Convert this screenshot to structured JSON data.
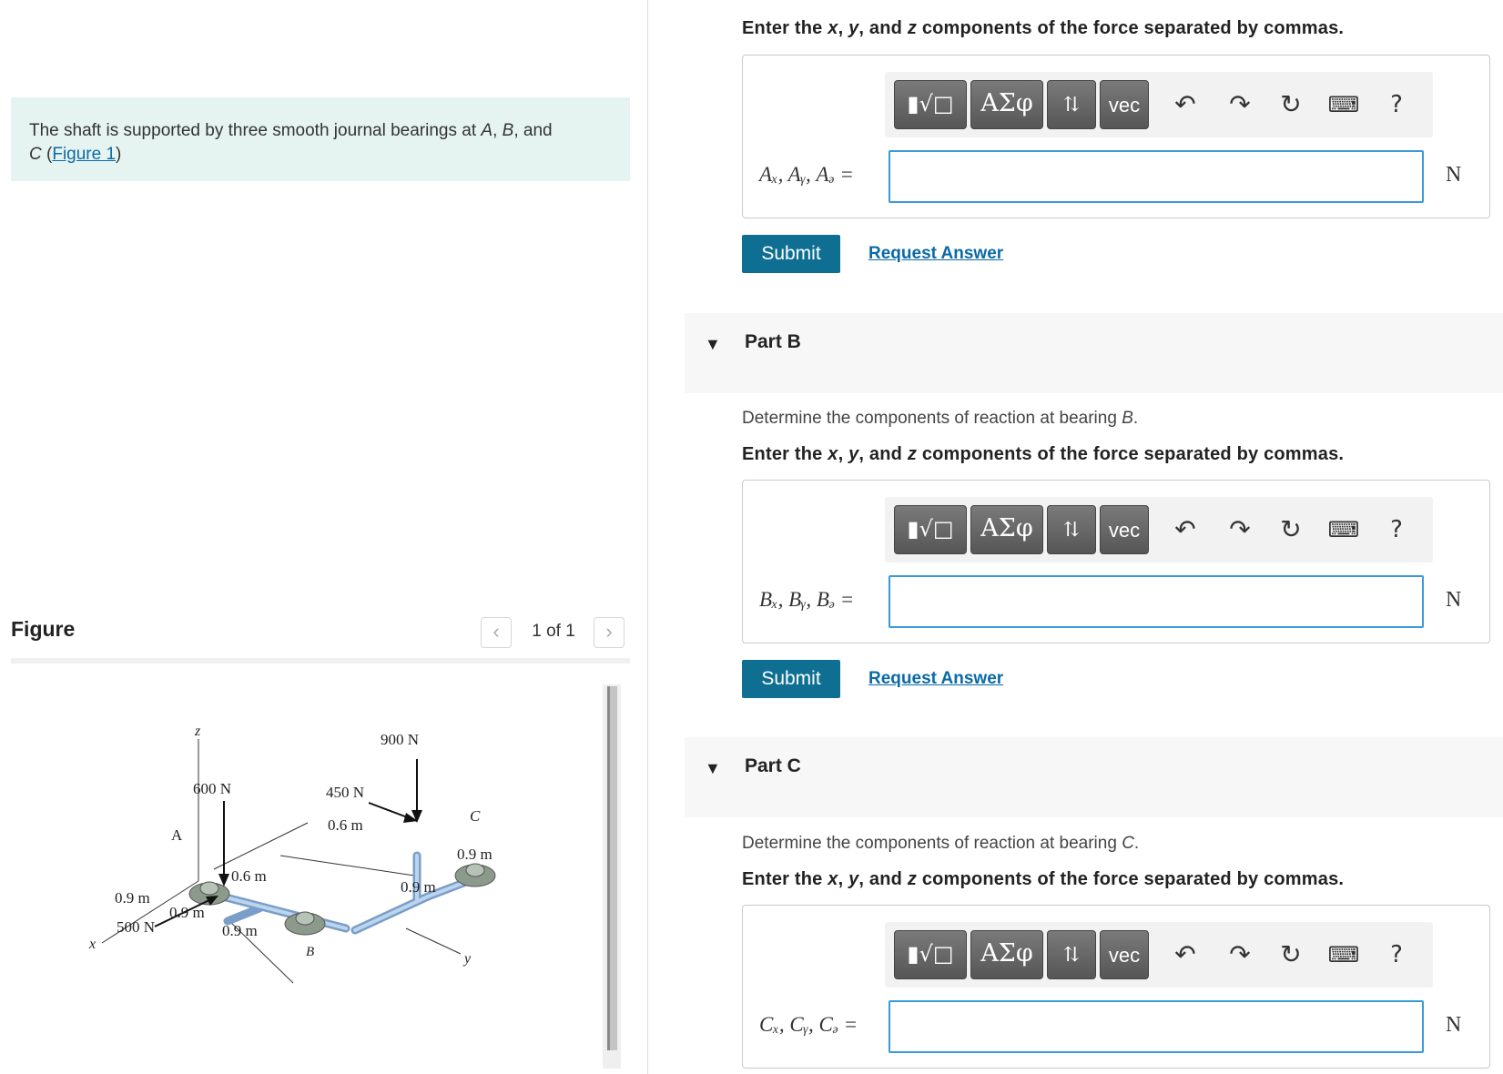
{
  "problem": {
    "text_prefix": "The shaft is supported by three smooth journal bearings at ",
    "bearing_a": "A",
    "sep1": ", ",
    "bearing_b": "B",
    "sep2": ", and",
    "bearing_c": "C",
    "paren_open": " (",
    "figure_link": "Figure 1",
    "paren_close": ")"
  },
  "figure": {
    "title": "Figure",
    "pager_text": "1 of 1",
    "prev_icon": "chevron-left-icon",
    "next_icon": "chevron-right-icon",
    "labels": {
      "z_axis": "z",
      "x_axis": "x",
      "y_axis": "y",
      "point_a": "A",
      "point_b": "B",
      "point_c": "C",
      "force_600": "600 N",
      "force_450": "450 N",
      "force_900": "900 N",
      "force_500": "500 N",
      "dim_06_top": "0.6 m",
      "dim_06_mid": "0.6 m",
      "dim_09_c": "0.9 m",
      "dim_09_y": "0.9 m",
      "dim_09_x": "0.9 m",
      "dim_09_a": "0.9 m",
      "dim_09_b": "0.9 m"
    }
  },
  "toolbar": {
    "fraction_glyph": "▮√□",
    "greek_label": "ΑΣφ",
    "sort_glyph": "⇅",
    "vec_label": "vec",
    "undo_glyph": "↶",
    "redo_glyph": "↷",
    "reset_glyph": "↻",
    "keyboard_glyph": "⌨",
    "help_glyph": "?"
  },
  "instruction": {
    "prefix": "Enter the ",
    "x": "x",
    "sep1": ", ",
    "y": "y",
    "sep2": ", and ",
    "z": "z",
    "suffix": " components of the force separated by commas."
  },
  "parts": {
    "a": {
      "answer_label": "Aₓ, Aᵧ, Aₔ =",
      "unit": "N",
      "submit_label": "Submit",
      "request_label": "Request Answer"
    },
    "b": {
      "title": "Part B",
      "question_prefix": "Determine the components of reaction at bearing ",
      "question_var": "B",
      "question_suffix": ".",
      "answer_label": "Bₓ, Bᵧ, Bₔ =",
      "unit": "N",
      "submit_label": "Submit",
      "request_label": "Request Answer"
    },
    "c": {
      "title": "Part C",
      "question_prefix": "Determine the components of reaction at bearing ",
      "question_var": "C",
      "question_suffix": ".",
      "answer_label": "Cₓ, Cᵧ, Cₔ =",
      "unit": "N"
    }
  }
}
